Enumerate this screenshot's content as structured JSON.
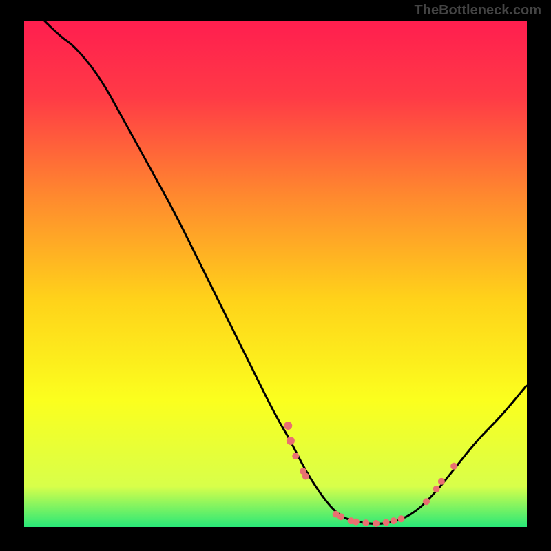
{
  "watermark": "TheBottleneck.com",
  "chart_data": {
    "type": "line",
    "title": "",
    "xlabel": "",
    "ylabel": "",
    "xlim": [
      0,
      100
    ],
    "ylim": [
      0,
      100
    ],
    "gradient_stops": [
      {
        "offset": 0,
        "color": "#ff1e4f"
      },
      {
        "offset": 15,
        "color": "#ff3a46"
      },
      {
        "offset": 35,
        "color": "#ff8a2e"
      },
      {
        "offset": 55,
        "color": "#ffd21a"
      },
      {
        "offset": 75,
        "color": "#fbff1e"
      },
      {
        "offset": 92,
        "color": "#d8ff4a"
      },
      {
        "offset": 100,
        "color": "#28e878"
      }
    ],
    "curve": [
      {
        "x": 4,
        "y": 100
      },
      {
        "x": 7,
        "y": 97
      },
      {
        "x": 10,
        "y": 95
      },
      {
        "x": 15,
        "y": 89
      },
      {
        "x": 20,
        "y": 80
      },
      {
        "x": 25,
        "y": 71
      },
      {
        "x": 30,
        "y": 62
      },
      {
        "x": 35,
        "y": 52
      },
      {
        "x": 40,
        "y": 42
      },
      {
        "x": 45,
        "y": 32
      },
      {
        "x": 50,
        "y": 22
      },
      {
        "x": 53,
        "y": 17
      },
      {
        "x": 56,
        "y": 11
      },
      {
        "x": 60,
        "y": 5
      },
      {
        "x": 63,
        "y": 2
      },
      {
        "x": 66,
        "y": 1
      },
      {
        "x": 70,
        "y": 0.5
      },
      {
        "x": 74,
        "y": 1
      },
      {
        "x": 78,
        "y": 3
      },
      {
        "x": 82,
        "y": 7
      },
      {
        "x": 86,
        "y": 12
      },
      {
        "x": 90,
        "y": 17
      },
      {
        "x": 95,
        "y": 22
      },
      {
        "x": 100,
        "y": 28
      }
    ],
    "markers": [
      {
        "x": 52.5,
        "y": 20,
        "r": 6
      },
      {
        "x": 53,
        "y": 17,
        "r": 6
      },
      {
        "x": 54,
        "y": 14,
        "r": 5
      },
      {
        "x": 55.5,
        "y": 11,
        "r": 5
      },
      {
        "x": 56,
        "y": 10,
        "r": 5
      },
      {
        "x": 62,
        "y": 2.5,
        "r": 5
      },
      {
        "x": 63,
        "y": 2,
        "r": 5
      },
      {
        "x": 65,
        "y": 1.2,
        "r": 5
      },
      {
        "x": 66,
        "y": 1,
        "r": 5
      },
      {
        "x": 68,
        "y": 0.8,
        "r": 5
      },
      {
        "x": 70,
        "y": 0.7,
        "r": 5
      },
      {
        "x": 72,
        "y": 0.9,
        "r": 5
      },
      {
        "x": 73.5,
        "y": 1.2,
        "r": 5
      },
      {
        "x": 75,
        "y": 1.6,
        "r": 5
      },
      {
        "x": 80,
        "y": 5,
        "r": 5
      },
      {
        "x": 82,
        "y": 7.5,
        "r": 5
      },
      {
        "x": 83,
        "y": 9,
        "r": 5
      },
      {
        "x": 85.5,
        "y": 12,
        "r": 5
      }
    ]
  }
}
